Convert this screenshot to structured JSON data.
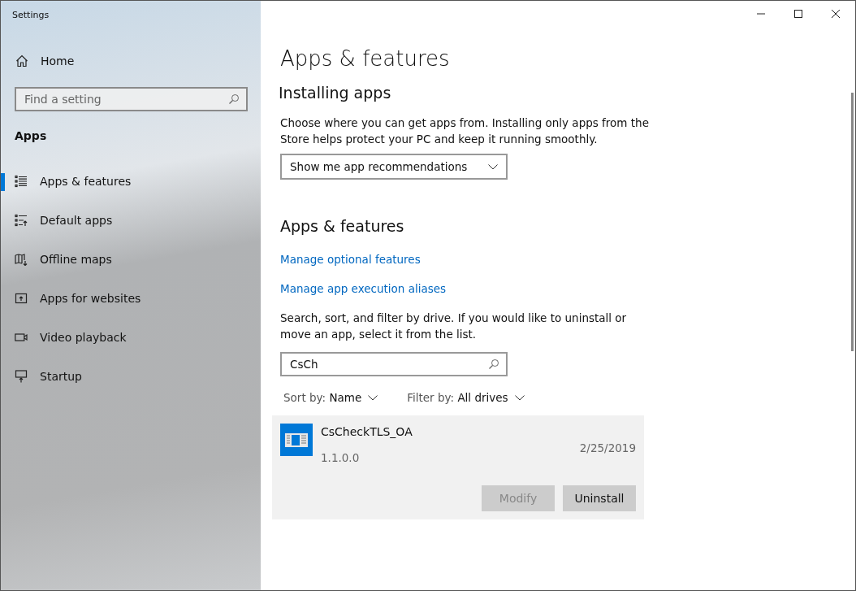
{
  "window": {
    "title": "Settings"
  },
  "sidebar": {
    "home": "Home",
    "search": {
      "placeholder": "Find a setting"
    },
    "section": "Apps",
    "items": [
      {
        "label": "Apps & features",
        "selected": true
      },
      {
        "label": "Default apps",
        "selected": false
      },
      {
        "label": "Offline maps",
        "selected": false
      },
      {
        "label": "Apps for websites",
        "selected": false
      },
      {
        "label": "Video playback",
        "selected": false
      },
      {
        "label": "Startup",
        "selected": false
      }
    ]
  },
  "main": {
    "title": "Apps & features",
    "installing": {
      "heading": "Installing apps",
      "description": "Choose where you can get apps from. Installing only apps from the Store helps protect your PC and keep it running smoothly.",
      "dropdown": "Show me app recommendations"
    },
    "features": {
      "heading": "Apps & features",
      "links": [
        "Manage optional features",
        "Manage app execution aliases"
      ],
      "description": "Search, sort, and filter by drive. If you would like to uninstall or move an app, select it from the list.",
      "search": {
        "value": "CsCh"
      },
      "sort": {
        "label": "Sort by:",
        "value": "Name"
      },
      "filter": {
        "label": "Filter by:",
        "value": "All drives"
      },
      "apps": [
        {
          "name": "CsCheckTLS_OA",
          "date": "2/25/2019",
          "version": "1.1.0.0",
          "selected": true,
          "buttons": [
            {
              "label": "Modify",
              "disabled": true
            },
            {
              "label": "Uninstall",
              "disabled": false
            }
          ]
        }
      ]
    }
  }
}
